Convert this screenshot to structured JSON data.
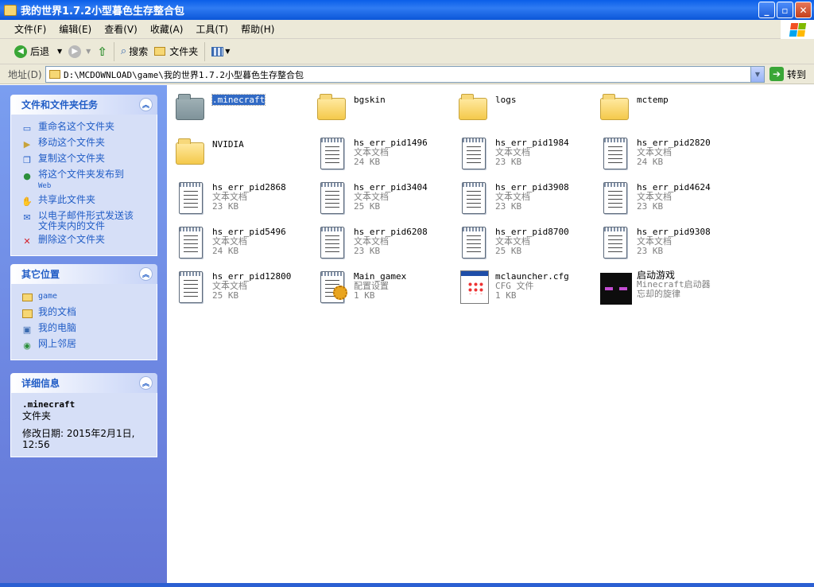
{
  "window": {
    "title": "我的世界1.7.2小型暮色生存整合包"
  },
  "menu": [
    "文件(F)",
    "编辑(E)",
    "查看(V)",
    "收藏(A)",
    "工具(T)",
    "帮助(H)"
  ],
  "toolbar": {
    "back": "后退",
    "search": "搜索",
    "folders": "文件夹"
  },
  "address": {
    "label": "地址(D)",
    "path": "D:\\MCDOWNLOAD\\game\\我的世界1.7.2小型暮色生存整合包",
    "go": "转到"
  },
  "sidebar": {
    "tasks": {
      "title": "文件和文件夹任务",
      "items": [
        "重命名这个文件夹",
        "移动这个文件夹",
        "复制这个文件夹",
        "将这个文件夹发布到",
        "共享此文件夹",
        "以电子邮件形式发送该",
        "删除这个文件夹"
      ],
      "publish_web": "Web",
      "email_line2": "文件夹内的文件"
    },
    "places": {
      "title": "其它位置",
      "items": [
        "game",
        "我的文档",
        "我的电脑",
        "网上邻居"
      ]
    },
    "details": {
      "title": "详细信息",
      "name": ".minecraft",
      "type": "文件夹",
      "modified_line1": "修改日期: 2015年2月1日,",
      "modified_line2": "12:56"
    }
  },
  "files": [
    {
      "name": ".minecraft",
      "kind": "folder-grey",
      "selected": true
    },
    {
      "name": "bgskin",
      "kind": "folder"
    },
    {
      "name": "logs",
      "kind": "folder"
    },
    {
      "name": "mctemp",
      "kind": "folder"
    },
    {
      "name": "NVIDIA",
      "kind": "folder"
    },
    {
      "name": "hs_err_pid1496",
      "type": "文本文档",
      "size": "24 KB",
      "kind": "text"
    },
    {
      "name": "hs_err_pid1984",
      "type": "文本文档",
      "size": "23 KB",
      "kind": "text"
    },
    {
      "name": "hs_err_pid2820",
      "type": "文本文档",
      "size": "24 KB",
      "kind": "text"
    },
    {
      "name": "hs_err_pid2868",
      "type": "文本文档",
      "size": "23 KB",
      "kind": "text"
    },
    {
      "name": "hs_err_pid3404",
      "type": "文本文档",
      "size": "25 KB",
      "kind": "text"
    },
    {
      "name": "hs_err_pid3908",
      "type": "文本文档",
      "size": "23 KB",
      "kind": "text"
    },
    {
      "name": "hs_err_pid4624",
      "type": "文本文档",
      "size": "23 KB",
      "kind": "text"
    },
    {
      "name": "hs_err_pid5496",
      "type": "文本文档",
      "size": "24 KB",
      "kind": "text"
    },
    {
      "name": "hs_err_pid6208",
      "type": "文本文档",
      "size": "23 KB",
      "kind": "text"
    },
    {
      "name": "hs_err_pid8700",
      "type": "文本文档",
      "size": "25 KB",
      "kind": "text"
    },
    {
      "name": "hs_err_pid9308",
      "type": "文本文档",
      "size": "23 KB",
      "kind": "text"
    },
    {
      "name": "hs_err_pid12800",
      "type": "文本文档",
      "size": "25 KB",
      "kind": "text"
    },
    {
      "name": "Main_gamex",
      "type": "配置设置",
      "size": "1 KB",
      "kind": "ini"
    },
    {
      "name": "mclauncher.cfg",
      "type": "CFG 文件",
      "size": "1 KB",
      "kind": "cfg"
    },
    {
      "name": "启动游戏",
      "type": "Minecraft启动器",
      "size": "忘却的旋律",
      "kind": "exe"
    }
  ]
}
